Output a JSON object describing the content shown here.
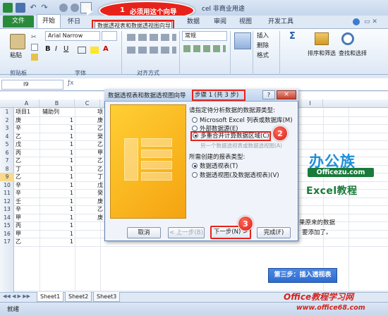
{
  "window": {
    "title_fragment": "cel 非商业用途"
  },
  "callout1": {
    "badge": "1",
    "text": "必须用这个向导"
  },
  "tooltip": {
    "text": "数据透视表和数据透视图向导"
  },
  "tabs": {
    "file": "文件",
    "home": "开始",
    "insert": "怀日",
    "data": "数据",
    "review": "审阅",
    "view": "视图",
    "developer": "开发工具"
  },
  "ribbon": {
    "font_name": "Arial Narrow",
    "number_format": "常规",
    "paste": "粘贴",
    "insert_btn": "插入",
    "delete_btn": "删除",
    "format_btn": "格式",
    "sort_filter": "排序和筛选",
    "find_select": "查找和选择",
    "groups": {
      "clipboard": "剪贴板",
      "font": "字体",
      "align": "对齐方式"
    }
  },
  "namebox": {
    "value": "I9"
  },
  "columns": [
    "A",
    "B",
    "C",
    "I"
  ],
  "rows": [
    {
      "n": "1",
      "a": "项目1",
      "b": "辅助列",
      "c": "项"
    },
    {
      "n": "2",
      "a": "庚",
      "b": "1",
      "c": "庚"
    },
    {
      "n": "3",
      "a": "辛",
      "b": "1",
      "c": "乙"
    },
    {
      "n": "4",
      "a": "乙",
      "b": "1",
      "c": "癸"
    },
    {
      "n": "5",
      "a": "戊",
      "b": "1",
      "c": "乙"
    },
    {
      "n": "6",
      "a": "丙",
      "b": "1",
      "c": "甲"
    },
    {
      "n": "7",
      "a": "乙",
      "b": "1",
      "c": "乙"
    },
    {
      "n": "8",
      "a": "丁",
      "b": "1",
      "c": "乙"
    },
    {
      "n": "9",
      "a": "乙",
      "b": "1",
      "c": "丁"
    },
    {
      "n": "10",
      "a": "辛",
      "b": "1",
      "c": "戊"
    },
    {
      "n": "11",
      "a": "辛",
      "b": "1",
      "c": "癸"
    },
    {
      "n": "12",
      "a": "壬",
      "b": "1",
      "c": "庚"
    },
    {
      "n": "13",
      "a": "辛",
      "b": "1",
      "c": "乙"
    },
    {
      "n": "14",
      "a": "甲",
      "b": "1",
      "c": "庚"
    },
    {
      "n": "15",
      "a": "丙",
      "b": "1",
      "c": ""
    },
    {
      "n": "16",
      "a": "甲",
      "b": "1",
      "c": ""
    },
    {
      "n": "17",
      "a": "乙",
      "b": "1",
      "c": ""
    }
  ],
  "dialog": {
    "title": "数据透视表和数据透视图向导",
    "step": "步骤 1 (共 3 步)",
    "help": "?",
    "close": "×",
    "source_label": "请指定待分析数据的数据源类型:",
    "source_options": [
      "Microsoft Excel 列表或数据库(M)",
      "外部数据源(E)",
      "多重合并计算数据区域(C)",
      "另一个数据透视表或数据透视图(A)"
    ],
    "report_label": "所需创建的报表类型:",
    "report_options": [
      "数据透视表(T)",
      "数据透视图(及数据透视表)(V)"
    ],
    "buttons": {
      "cancel": "取消",
      "back": "< 上一步(B)",
      "next": "下一步(N) >",
      "finish": "完成(F)"
    }
  },
  "badge2": "2",
  "badge3": "3",
  "logo": {
    "brand": "办公族",
    "site": "Officezu.com",
    "tutorial": "Excel教程"
  },
  "side_note": {
    "line1": "果原来的数据",
    "line2": "要添加了。"
  },
  "step_banner": "第三步：插入透视表",
  "sheet_tabs": [
    "Sheet1",
    "Sheet2",
    "Sheet3"
  ],
  "status": {
    "ready": "就绪"
  },
  "watermark": {
    "line1": "Office教程学习网",
    "line2": "www.office68.com"
  },
  "colors": {
    "accent_red": "#e8221a",
    "file_tab": "#2a8a3c",
    "logo_blue": "#1e8fd8",
    "logo_green": "#1a7a3a",
    "banner_blue": "#2f6cd0"
  }
}
